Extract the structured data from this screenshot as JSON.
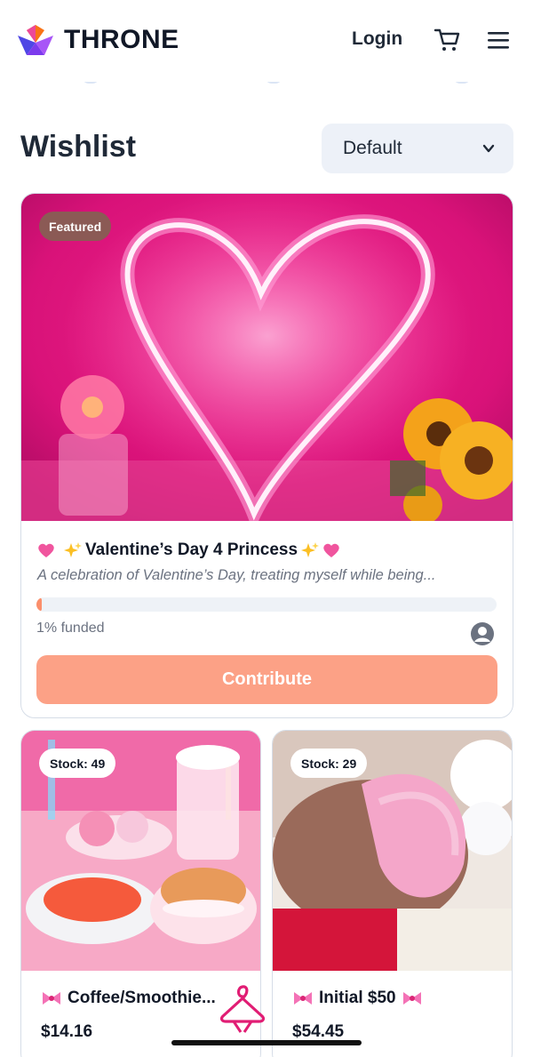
{
  "header": {
    "brand": "THRONE",
    "login_label": "Login",
    "cart_icon": "cart-icon",
    "menu_icon": "menu-icon"
  },
  "wishlist": {
    "title": "Wishlist",
    "sort_selected": "Default"
  },
  "featured": {
    "badge": "Featured",
    "title": "Valentine’s Day 4 Princess",
    "description": "A celebration of Valentine’s Day, treating myself while being...",
    "progress_percent": 1,
    "funded_label": "1% funded",
    "cta": "Contribute"
  },
  "products": [
    {
      "stock": "Stock: 49",
      "title": "Coffee/Smoothie...",
      "price": "$14.16"
    },
    {
      "stock": "Stock: 29",
      "title": "Initial $50",
      "price": "$54.45"
    }
  ],
  "colors": {
    "accent": "#fca186",
    "progress": "#fb8f6b",
    "featured_badge": "#8b5a55",
    "sort_bg": "#edf1f8"
  }
}
